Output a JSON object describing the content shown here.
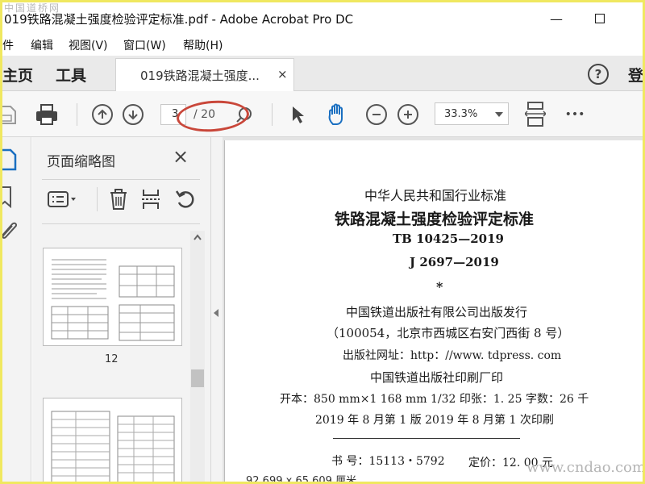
{
  "watermark_top": "中国道桥网",
  "watermark_bottom": "www.cndao.com",
  "window": {
    "title": "019铁路混凝土强度检验评定标准.pdf - Adobe Acrobat Pro DC",
    "minimize": "—",
    "maximize": "☐"
  },
  "menu": [
    "件",
    "编辑",
    "视图(V)",
    "窗口(W)",
    "帮助(H)"
  ],
  "tabs": {
    "home": "主页",
    "tools": "工具",
    "doc_tab": "019铁路混凝土强度...",
    "doc_tab_close": "×",
    "help": "?",
    "login": "登"
  },
  "toolbar": {
    "page_current": "3",
    "page_total": "/ 20",
    "zoom": "33.3%",
    "more": "•••"
  },
  "thumbnails_panel": {
    "title": "页面缩略图",
    "close": "×",
    "thumb_label": "12"
  },
  "document": {
    "lines": [
      "中华人民共和国行业标准",
      "铁路混凝土强度检验评定标准",
      "TB 10425—2019",
      "J 2697—2019",
      "*",
      "中国铁道出版社有限公司出版发行",
      "（100054，北京市西城区右安门西街 8 号）",
      "出版社网址：http：//www. tdpress. com",
      "中国铁道出版社印刷厂印",
      "开本：850 mm×1 168 mm  1/32  印张：1. 25  字数：26 千",
      "2019 年 8 月第 1 版  2019 年 8 月第 1 次印刷",
      "书  号：15113・5792",
      "定价：12. 00 元"
    ]
  },
  "status": {
    "page_size": "92.699 x 65.609 厘米"
  },
  "colors": {
    "outer_border": "#f0e860",
    "annotation_ellipse": "#c9473a",
    "hand_tool": "#1a6fc1",
    "rail_active": "#1a6fc1"
  }
}
